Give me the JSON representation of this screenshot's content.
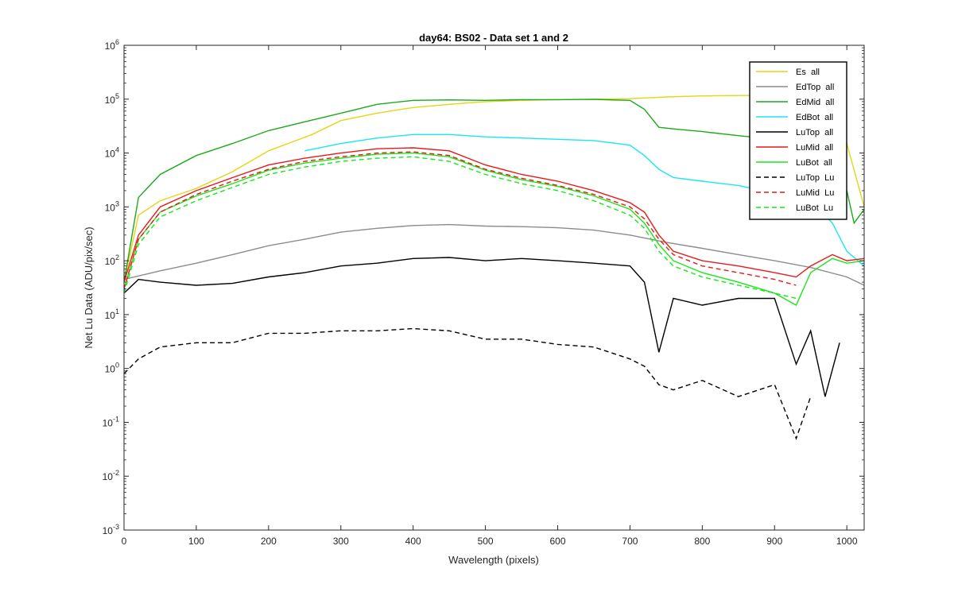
{
  "chart_data": {
    "type": "line",
    "title": "day64: BS02 - Data set 1 and 2",
    "xlabel": "Wavelength (pixels)",
    "ylabel": "Net Lu Data (ADU/pix/sec)",
    "xlim": [
      0,
      1024
    ],
    "ylim": [
      0.001,
      1000000
    ],
    "yscale": "log",
    "x_ticks": [
      0,
      100,
      200,
      300,
      400,
      500,
      600,
      700,
      800,
      900,
      1000
    ],
    "y_tick_exponents": [
      -3,
      -2,
      -1,
      0,
      1,
      2,
      3,
      4,
      5,
      6
    ],
    "y_tick_base": "10",
    "grid": false,
    "legend_position": "top-right",
    "series": [
      {
        "name": "Es  all",
        "color": "#e6d419",
        "style": "solid",
        "points": [
          [
            0,
            40
          ],
          [
            20,
            700
          ],
          [
            50,
            1300
          ],
          [
            100,
            2200
          ],
          [
            150,
            4500
          ],
          [
            200,
            11000
          ],
          [
            260,
            22000
          ],
          [
            300,
            40000
          ],
          [
            350,
            55000
          ],
          [
            400,
            70000
          ],
          [
            450,
            80000
          ],
          [
            500,
            90000
          ],
          [
            550,
            95000
          ],
          [
            600,
            98000
          ],
          [
            650,
            100000
          ],
          [
            700,
            102000
          ],
          [
            750,
            110000
          ],
          [
            800,
            115000
          ],
          [
            850,
            117000
          ],
          [
            900,
            118000
          ],
          [
            950,
            118000
          ],
          [
            980,
            80000
          ],
          [
            1000,
            15000
          ],
          [
            1024,
            1000
          ]
        ]
      },
      {
        "name": "EdTop  all",
        "color": "#8c8c8c",
        "style": "solid",
        "points": [
          [
            0,
            45
          ],
          [
            50,
            65
          ],
          [
            100,
            90
          ],
          [
            150,
            130
          ],
          [
            200,
            190
          ],
          [
            250,
            250
          ],
          [
            300,
            340
          ],
          [
            350,
            400
          ],
          [
            400,
            450
          ],
          [
            450,
            470
          ],
          [
            500,
            440
          ],
          [
            550,
            430
          ],
          [
            600,
            410
          ],
          [
            650,
            370
          ],
          [
            700,
            300
          ],
          [
            750,
            220
          ],
          [
            800,
            170
          ],
          [
            850,
            130
          ],
          [
            900,
            100
          ],
          [
            950,
            75
          ],
          [
            1000,
            50
          ],
          [
            1024,
            35
          ]
        ]
      },
      {
        "name": "EdMid  all",
        "color": "#1aaa1a",
        "style": "solid",
        "points": [
          [
            0,
            40
          ],
          [
            20,
            1500
          ],
          [
            50,
            4000
          ],
          [
            100,
            9000
          ],
          [
            150,
            15000
          ],
          [
            200,
            26000
          ],
          [
            250,
            38000
          ],
          [
            300,
            55000
          ],
          [
            350,
            80000
          ],
          [
            400,
            95000
          ],
          [
            450,
            97000
          ],
          [
            500,
            95000
          ],
          [
            550,
            98000
          ],
          [
            600,
            98000
          ],
          [
            650,
            99000
          ],
          [
            700,
            95000
          ],
          [
            720,
            65000
          ],
          [
            740,
            30000
          ],
          [
            760,
            28000
          ],
          [
            800,
            25000
          ],
          [
            850,
            21000
          ],
          [
            900,
            18000
          ],
          [
            950,
            14000
          ],
          [
            980,
            10000
          ],
          [
            1000,
            2000
          ],
          [
            1010,
            500
          ],
          [
            1024,
            900
          ]
        ]
      },
      {
        "name": "EdBot  all",
        "color": "#1ae6f0",
        "style": "solid",
        "points": [
          [
            250,
            11000
          ],
          [
            300,
            15000
          ],
          [
            350,
            19000
          ],
          [
            400,
            22000
          ],
          [
            450,
            22000
          ],
          [
            500,
            20000
          ],
          [
            550,
            19000
          ],
          [
            600,
            18000
          ],
          [
            650,
            17000
          ],
          [
            700,
            14000
          ],
          [
            720,
            9000
          ],
          [
            740,
            5000
          ],
          [
            760,
            3500
          ],
          [
            800,
            3000
          ],
          [
            850,
            2500
          ],
          [
            900,
            1800
          ],
          [
            950,
            1300
          ],
          [
            980,
            500
          ],
          [
            1000,
            150
          ],
          [
            1024,
            80
          ]
        ]
      },
      {
        "name": "LuTop  all",
        "color": "#000000",
        "style": "solid",
        "points": [
          [
            0,
            25
          ],
          [
            20,
            45
          ],
          [
            50,
            40
          ],
          [
            100,
            35
          ],
          [
            150,
            38
          ],
          [
            200,
            50
          ],
          [
            250,
            60
          ],
          [
            300,
            80
          ],
          [
            350,
            90
          ],
          [
            400,
            110
          ],
          [
            450,
            115
          ],
          [
            500,
            100
          ],
          [
            550,
            110
          ],
          [
            600,
            100
          ],
          [
            650,
            90
          ],
          [
            700,
            80
          ],
          [
            720,
            40
          ],
          [
            740,
            2
          ],
          [
            760,
            20
          ],
          [
            800,
            15
          ],
          [
            850,
            20
          ],
          [
            900,
            20
          ],
          [
            930,
            1.2
          ],
          [
            950,
            5
          ],
          [
            970,
            0.3
          ],
          [
            990,
            3
          ]
        ]
      },
      {
        "name": "LuMid  all",
        "color": "#e61a1a",
        "style": "solid",
        "points": [
          [
            0,
            40
          ],
          [
            20,
            300
          ],
          [
            50,
            1000
          ],
          [
            100,
            2000
          ],
          [
            150,
            3500
          ],
          [
            200,
            6000
          ],
          [
            250,
            8000
          ],
          [
            300,
            10000
          ],
          [
            350,
            12000
          ],
          [
            400,
            12500
          ],
          [
            450,
            11000
          ],
          [
            500,
            6000
          ],
          [
            550,
            4000
          ],
          [
            600,
            3000
          ],
          [
            650,
            2000
          ],
          [
            700,
            1200
          ],
          [
            720,
            800
          ],
          [
            740,
            300
          ],
          [
            760,
            150
          ],
          [
            800,
            100
          ],
          [
            850,
            80
          ],
          [
            900,
            60
          ],
          [
            930,
            50
          ],
          [
            950,
            80
          ],
          [
            980,
            130
          ],
          [
            1000,
            100
          ],
          [
            1024,
            110
          ]
        ]
      },
      {
        "name": "LuBot  all",
        "color": "#1ae61a",
        "style": "solid",
        "points": [
          [
            0,
            30
          ],
          [
            20,
            250
          ],
          [
            50,
            800
          ],
          [
            100,
            1600
          ],
          [
            150,
            2700
          ],
          [
            200,
            4800
          ],
          [
            250,
            6500
          ],
          [
            300,
            8000
          ],
          [
            350,
            9500
          ],
          [
            400,
            10000
          ],
          [
            450,
            8500
          ],
          [
            500,
            4800
          ],
          [
            550,
            3200
          ],
          [
            600,
            2400
          ],
          [
            650,
            1600
          ],
          [
            700,
            900
          ],
          [
            720,
            500
          ],
          [
            740,
            200
          ],
          [
            760,
            100
          ],
          [
            800,
            60
          ],
          [
            850,
            40
          ],
          [
            900,
            25
          ],
          [
            930,
            15
          ],
          [
            950,
            60
          ],
          [
            980,
            110
          ],
          [
            1000,
            90
          ],
          [
            1024,
            100
          ]
        ]
      },
      {
        "name": "LuTop  Lu",
        "color": "#000000",
        "style": "dashed",
        "points": [
          [
            0,
            0.8
          ],
          [
            20,
            1.5
          ],
          [
            50,
            2.5
          ],
          [
            100,
            3
          ],
          [
            150,
            3
          ],
          [
            200,
            4.5
          ],
          [
            250,
            4.5
          ],
          [
            300,
            5
          ],
          [
            350,
            5
          ],
          [
            400,
            5.5
          ],
          [
            450,
            5
          ],
          [
            500,
            3.5
          ],
          [
            550,
            3.5
          ],
          [
            600,
            2.8
          ],
          [
            650,
            2.5
          ],
          [
            700,
            1.5
          ],
          [
            720,
            1.1
          ],
          [
            740,
            0.5
          ],
          [
            760,
            0.4
          ],
          [
            800,
            0.6
          ],
          [
            850,
            0.3
          ],
          [
            900,
            0.5
          ],
          [
            930,
            0.05
          ],
          [
            950,
            0.3
          ]
        ]
      },
      {
        "name": "LuMid  Lu",
        "color": "#e61a1a",
        "style": "dashed",
        "points": [
          [
            0,
            30
          ],
          [
            20,
            250
          ],
          [
            50,
            800
          ],
          [
            100,
            1700
          ],
          [
            150,
            3000
          ],
          [
            200,
            5000
          ],
          [
            250,
            7000
          ],
          [
            300,
            8500
          ],
          [
            350,
            10000
          ],
          [
            400,
            10500
          ],
          [
            450,
            9000
          ],
          [
            500,
            5000
          ],
          [
            550,
            3400
          ],
          [
            600,
            2500
          ],
          [
            650,
            1700
          ],
          [
            700,
            1000
          ],
          [
            720,
            600
          ],
          [
            740,
            250
          ],
          [
            760,
            130
          ],
          [
            800,
            80
          ],
          [
            850,
            60
          ],
          [
            900,
            45
          ],
          [
            930,
            35
          ]
        ]
      },
      {
        "name": "LuBot  Lu",
        "color": "#1ae61a",
        "style": "dashed",
        "points": [
          [
            0,
            25
          ],
          [
            20,
            200
          ],
          [
            50,
            650
          ],
          [
            100,
            1300
          ],
          [
            150,
            2300
          ],
          [
            200,
            4000
          ],
          [
            250,
            5500
          ],
          [
            300,
            7000
          ],
          [
            350,
            8000
          ],
          [
            400,
            8500
          ],
          [
            450,
            7000
          ],
          [
            500,
            4000
          ],
          [
            550,
            2700
          ],
          [
            600,
            2000
          ],
          [
            650,
            1300
          ],
          [
            700,
            700
          ],
          [
            720,
            400
          ],
          [
            740,
            150
          ],
          [
            760,
            80
          ],
          [
            800,
            50
          ],
          [
            850,
            35
          ],
          [
            900,
            25
          ],
          [
            930,
            20
          ]
        ]
      }
    ]
  }
}
